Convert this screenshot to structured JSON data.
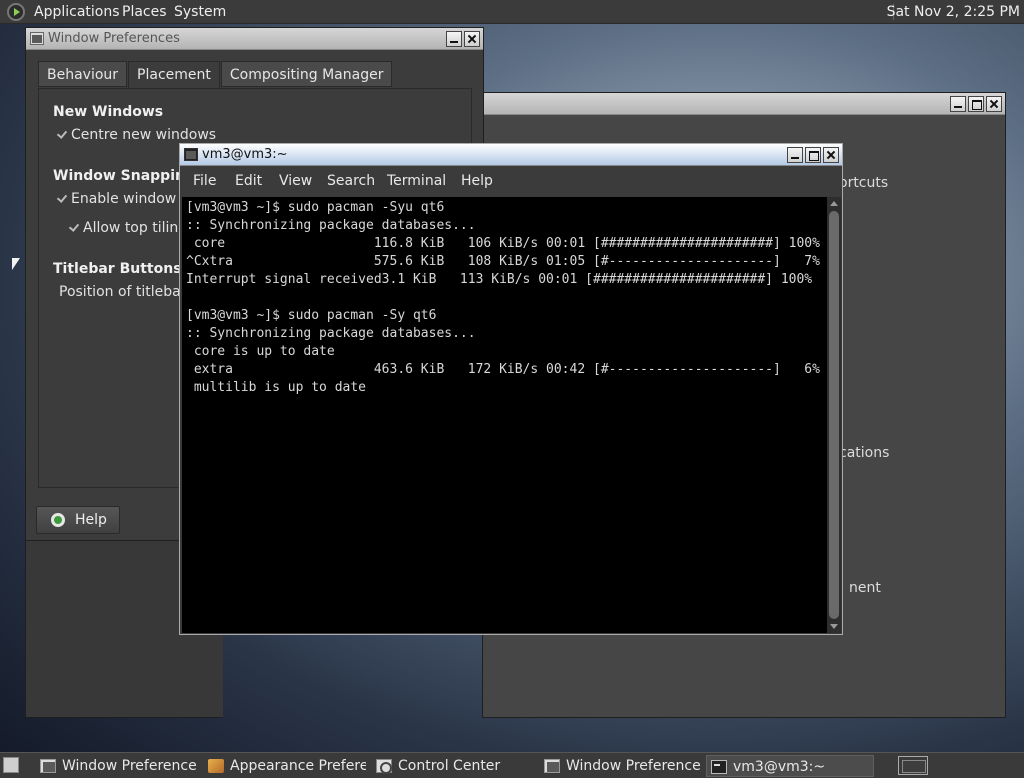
{
  "top_panel": {
    "menus": [
      "Applications",
      "Places",
      "System"
    ],
    "clock": "Sat Nov  2,  2:25 PM"
  },
  "appearance_window": {
    "labels": [
      "ortcuts",
      "cations",
      "nent"
    ]
  },
  "prefs_window": {
    "title": "Window Preferences",
    "tabs": [
      "Behaviour",
      "Placement",
      "Compositing Manager"
    ],
    "sections": {
      "new_windows": "New Windows",
      "centre_new_windows": "Centre new windows",
      "window_snapping": "Window Snapping",
      "enable_window_tiling": "Enable window tili",
      "allow_top_tiling": "Allow top tiling",
      "titlebar_buttons": "Titlebar Buttons",
      "position_titlebar": "Position of titlebar b"
    },
    "help_button": "Help"
  },
  "terminal": {
    "title": "vm3@vm3:~",
    "menu": [
      "File",
      "Edit",
      "View",
      "Search",
      "Terminal",
      "Help"
    ],
    "lines": [
      "[vm3@vm3 ~]$ sudo pacman -Syu qt6",
      ":: Synchronizing package databases...",
      " core                   116.8 KiB   106 KiB/s 00:01 [######################] 100%",
      "^Cxtra                  575.6 KiB   108 KiB/s 01:05 [#---------------------]   7%",
      "Interrupt signal received3.1 KiB   113 KiB/s 00:01 [######################] 100%",
      "",
      "[vm3@vm3 ~]$ sudo pacman -Sy qt6",
      ":: Synchronizing package databases...",
      " core is up to date",
      " extra                  463.6 KiB   172 KiB/s 00:42 [#---------------------]   6%",
      " multilib is up to date"
    ]
  },
  "taskbar": {
    "items": [
      {
        "label": "Window Preferences",
        "icon": "window-icon"
      },
      {
        "label": "Appearance Prefere...",
        "icon": "appearance-icon"
      },
      {
        "label": "Control Center",
        "icon": "control-center-icon"
      },
      {
        "label": "Window Preferences",
        "icon": "window-icon"
      },
      {
        "label": "vm3@vm3:~",
        "icon": "terminal-icon"
      }
    ]
  }
}
